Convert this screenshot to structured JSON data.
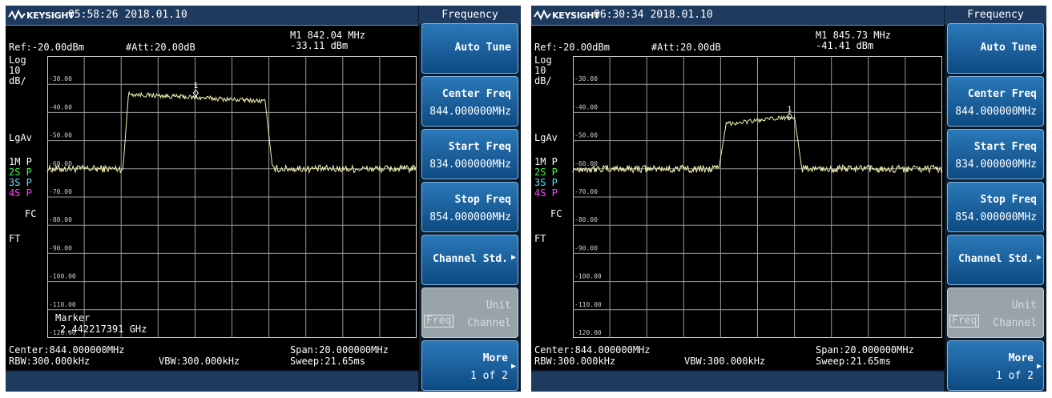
{
  "panels": [
    {
      "brand": "KEYSIGHT",
      "datetime": "05:58:26 2018.01.10",
      "menu_title": "Frequency",
      "ref": "Ref:-20.00dBm",
      "att": "#Att:20.00dB",
      "marker_freq": "M1 842.04 MHz",
      "marker_amp": "-33.11 dBm",
      "scale_log": "Log",
      "scale_div": "10",
      "scale_unit": "dB/",
      "lgav": "LgAv",
      "trace1": "1M P",
      "trace2": "2S P",
      "trace3": "3S P",
      "trace4": "4S P",
      "fc": "FC",
      "ft": "FT",
      "y_ticks": [
        "-30.00",
        "-40.00",
        "-50.00",
        "-60.00",
        "-70.00",
        "-80.00",
        "-90.00",
        "-100.00",
        "-110.00",
        "-120.00"
      ],
      "marker_label": "1",
      "marker_box_title": "Marker",
      "marker_box_value": "2.442217391 GHz",
      "center": "Center:844.000000MHz",
      "span": "Span:20.000000MHz",
      "rbw": "RBW:300.000kHz",
      "vbw": "VBW:300.000kHz",
      "sweep": "Sweep:21.65ms",
      "softkeys": {
        "auto_tune": "Auto Tune",
        "center_freq_label": "Center Freq",
        "center_freq_value": "844.000000MHz",
        "start_freq_label": "Start Freq",
        "start_freq_value": "834.000000MHz",
        "stop_freq_label": "Stop Freq",
        "stop_freq_value": "854.000000MHz",
        "channel_std": "Channel Std.",
        "unit_label": "Unit",
        "unit_freq_tag": "Freq",
        "unit_channel": "Channel",
        "more_label": "More",
        "more_page": "1 of 2"
      },
      "trace_data": {
        "baseline_dbm": -60.0,
        "plateau_start_dbm": -33.5,
        "plateau_end_dbm": -36.0,
        "rise_start_mhz": 838.1,
        "plateau_start_mhz": 838.4,
        "plateau_end_mhz": 845.8,
        "fall_end_mhz": 846.2,
        "marker_mhz": 842.04,
        "marker_dbm": -33.11
      }
    },
    {
      "brand": "KEYSIGHT",
      "datetime": "06:30:34 2018.01.10",
      "menu_title": "Frequency",
      "ref": "Ref:-20.00dBm",
      "att": "#Att:20.00dB",
      "marker_freq": "M1 845.73 MHz",
      "marker_amp": "-41.41 dBm",
      "scale_log": "Log",
      "scale_div": "10",
      "scale_unit": "dB/",
      "lgav": "LgAv",
      "trace1": "1M P",
      "trace2": "2S P",
      "trace3": "3S P",
      "trace4": "4S P",
      "fc": "FC",
      "ft": "FT",
      "y_ticks": [
        "-30.00",
        "-40.00",
        "-50.00",
        "-60.00",
        "-70.00",
        "-80.00",
        "-90.00",
        "-100.00",
        "-110.00",
        "-120.00"
      ],
      "marker_label": "1",
      "center": "Center:844.000000MHz",
      "span": "Span:20.000000MHz",
      "rbw": "RBW:300.000kHz",
      "vbw": "VBW:300.000kHz",
      "sweep": "Sweep:21.65ms",
      "softkeys": {
        "auto_tune": "Auto Tune",
        "center_freq_label": "Center Freq",
        "center_freq_value": "844.000000MHz",
        "start_freq_label": "Start Freq",
        "start_freq_value": "834.000000MHz",
        "stop_freq_label": "Stop Freq",
        "stop_freq_value": "854.000000MHz",
        "channel_std": "Channel Std.",
        "unit_label": "Unit",
        "unit_freq_tag": "Freq",
        "unit_channel": "Channel",
        "more_label": "More",
        "more_page": "1 of 2"
      },
      "trace_data": {
        "baseline_dbm": -60.0,
        "plateau_start_dbm": -44.0,
        "plateau_end_dbm": -41.5,
        "rise_start_mhz": 841.9,
        "plateau_start_mhz": 842.3,
        "plateau_end_mhz": 846.0,
        "fall_end_mhz": 846.4,
        "marker_mhz": 845.73,
        "marker_dbm": -41.41
      }
    }
  ],
  "colors": {
    "background": "#0b1b2b",
    "header": "#1e3a5f",
    "trace": "#f2f2b0",
    "softkey": "#1f66a6",
    "softkey_disabled": "#9aa3a8"
  }
}
